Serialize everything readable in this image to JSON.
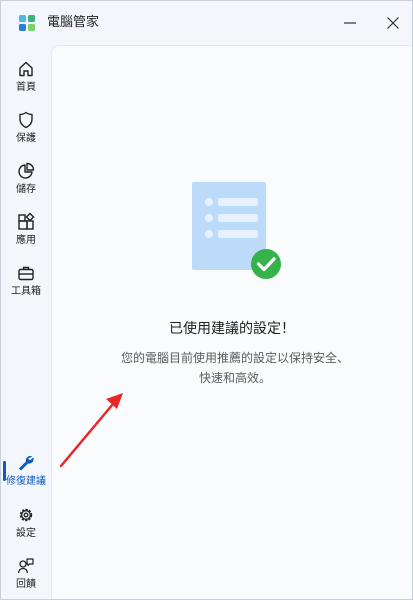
{
  "app": {
    "title": "電腦管家"
  },
  "colors": {
    "accent": "#0a5cc2",
    "success": "#35b34a",
    "annotation_arrow": "#e8262a"
  },
  "window_controls": {
    "minimize_icon": "minimize-icon",
    "close_icon": "close-icon"
  },
  "sidebar": {
    "items": [
      {
        "label": "首頁",
        "icon": "home-icon"
      },
      {
        "label": "保護",
        "icon": "shield-icon"
      },
      {
        "label": "儲存",
        "icon": "pie-chart-icon"
      },
      {
        "label": "應用",
        "icon": "apps-icon"
      },
      {
        "label": "工具箱",
        "icon": "toolbox-icon"
      },
      {
        "label": "修復建議",
        "icon": "wrench-icon",
        "active": true
      },
      {
        "label": "設定",
        "icon": "gear-icon"
      },
      {
        "label": "回饋",
        "icon": "feedback-icon"
      }
    ]
  },
  "main": {
    "heading": "已使用建議的設定！",
    "description": "您的電腦目前使用推薦的設定以保持安全、快速和高效。"
  }
}
